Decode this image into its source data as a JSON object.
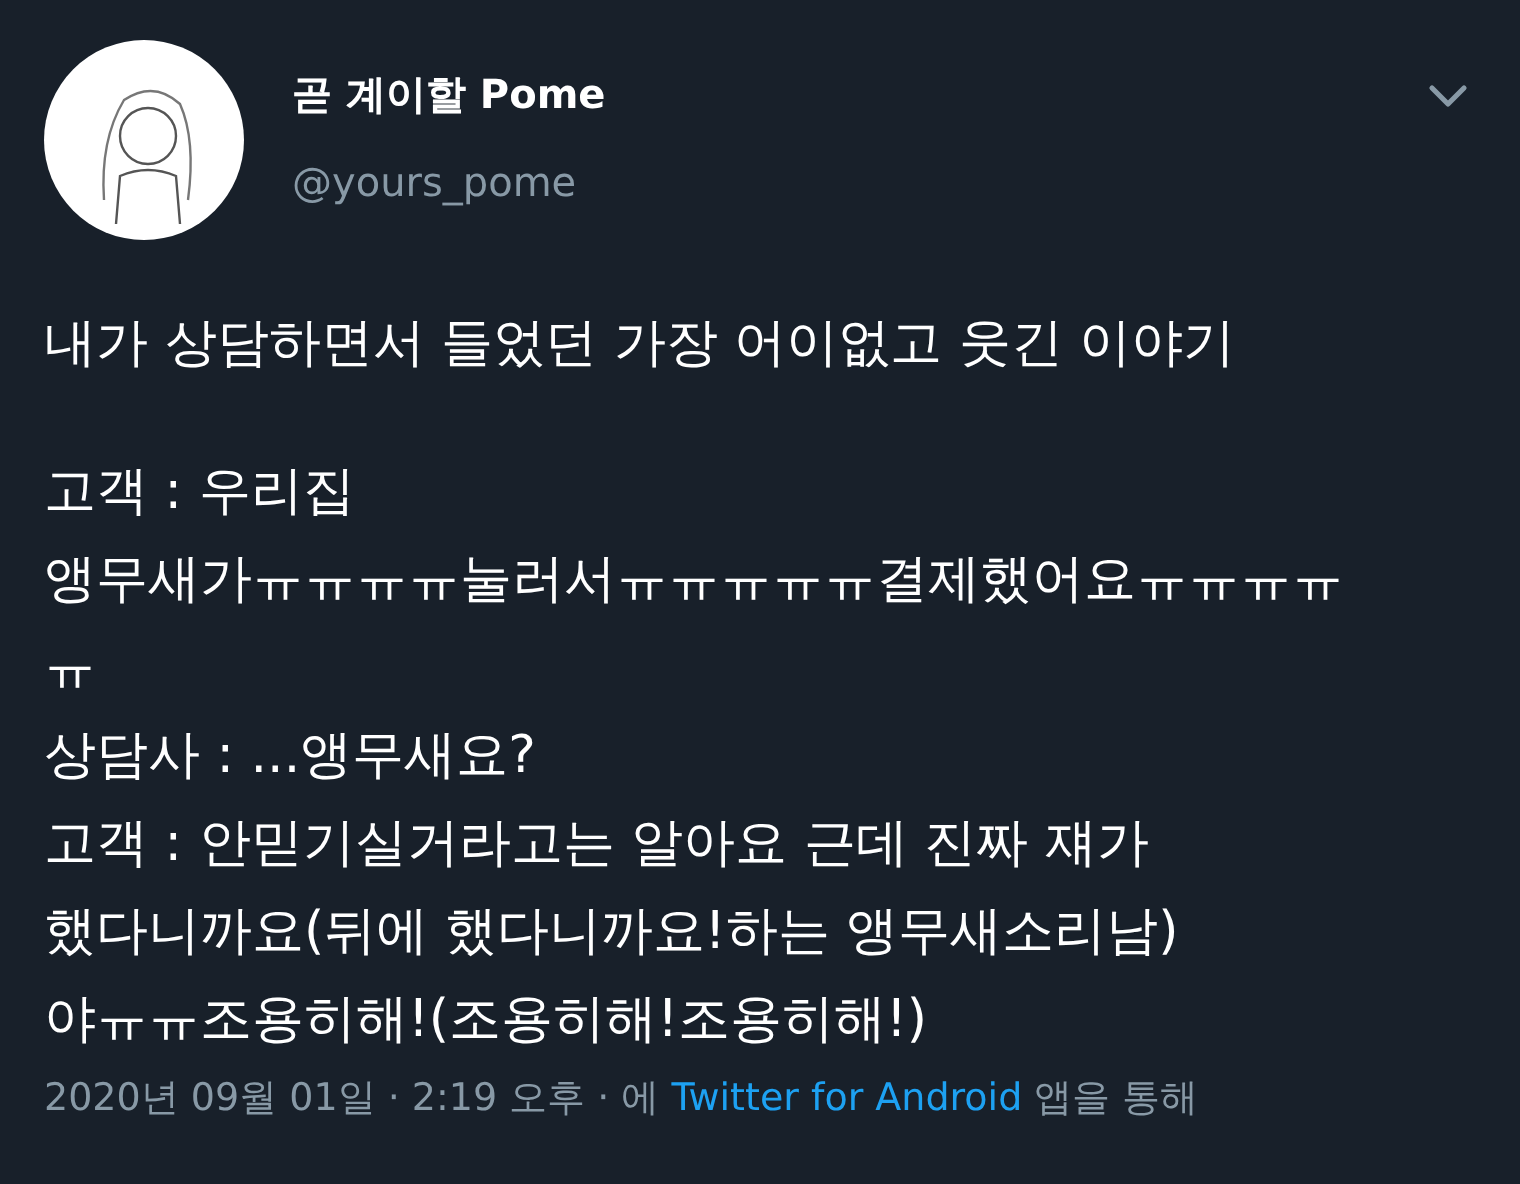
{
  "author": {
    "display_name": "곧 계이할 Pome",
    "handle": "@yours_pome"
  },
  "tweet": {
    "paragraphs": [
      [
        "내가 상담하면서 들었던 가장 어이없고 웃긴 이야기"
      ],
      [
        "고객 : 우리집",
        "앵무새가ㅠㅠㅠㅠ눌러서ㅠㅠㅠㅠㅠ결제했어요ㅠㅠㅠㅠ",
        "ㅠ",
        "상담사 : ...앵무새요?",
        "고객 : 안믿기실거라고는 알아요 근데 진짜 쟤가",
        "했다니까요(뒤에 했다니까요!하는 앵무새소리남)",
        "야ㅠㅠ조용히해!(조용히해!조용히해!)"
      ]
    ]
  },
  "meta": {
    "timestamp": "2020년 09월 01일 · 2:19 오후 · 에 ",
    "source": "Twitter for Android",
    "suffix": " 앱을 통해"
  }
}
